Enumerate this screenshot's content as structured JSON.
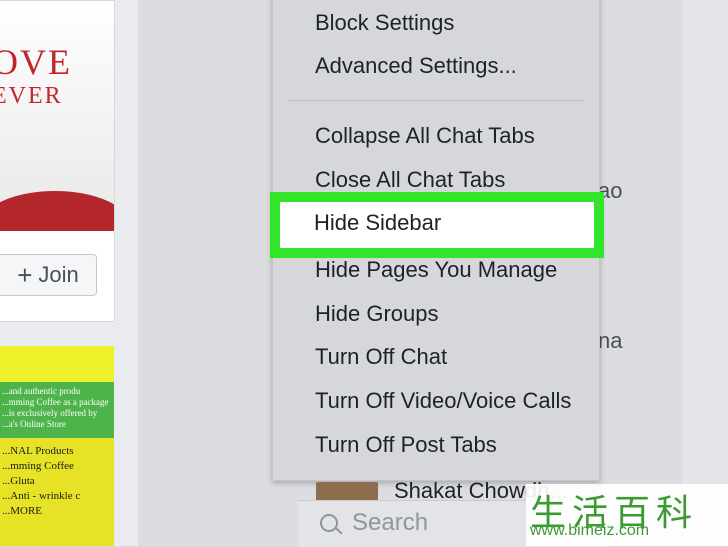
{
  "left_ad": {
    "headline_line1": "OVE",
    "headline_line2": "EVER",
    "join_label": "Join",
    "join_icon": "plus-icon"
  },
  "left_ad2": {
    "mid_lines": [
      "...and authentic produ",
      "...mming Coffee as a package",
      "...is exclusively offered by",
      "...a's Online Store"
    ],
    "bottom_lines": [
      "...NAL Products",
      "...mming Coffee",
      "...Gluta",
      "...Anti - wrinkle c",
      "...MORE"
    ]
  },
  "menu": {
    "items_top": [
      "Block Settings",
      "Advanced Settings..."
    ],
    "items_bottom": [
      "Collapse All Chat Tabs",
      "Close All Chat Tabs",
      "Hide Sidebar",
      "Hide Pages You Manage",
      "Hide Groups",
      "Turn Off Chat",
      "Turn Off Video/Voice Calls",
      "Turn Off Post Tabs"
    ],
    "highlighted_item": "Hide Sidebar",
    "highlight_color": "#33e52a"
  },
  "sidebar_fragments": [
    "ao",
    "na"
  ],
  "chat": {
    "contact_name": "Shakat Chowdh..."
  },
  "search": {
    "placeholder": "Search",
    "icon": "search-icon"
  },
  "watermark": {
    "chars": "生活百科",
    "url": "www.bimeiz.com"
  }
}
